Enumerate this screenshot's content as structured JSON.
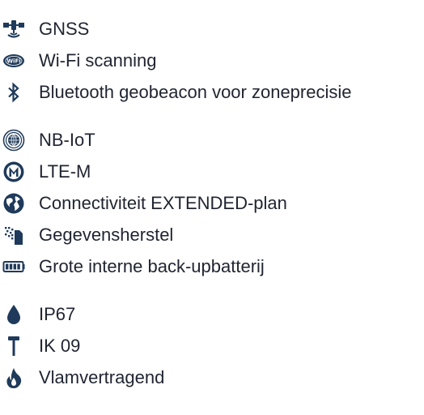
{
  "groups": [
    {
      "items": [
        {
          "icon": "satellite-icon",
          "label": "GNSS"
        },
        {
          "icon": "wifi-badge-icon",
          "label": "Wi-Fi scanning"
        },
        {
          "icon": "bluetooth-icon",
          "label": "Bluetooth geobeacon voor zoneprecisie"
        }
      ]
    },
    {
      "items": [
        {
          "icon": "nbiot-antenna-icon",
          "label": "NB-IoT"
        },
        {
          "icon": "ltem-badge-icon",
          "label": "LTE-M"
        },
        {
          "icon": "globe-icon",
          "label": "Connectiviteit EXTENDED-plan"
        },
        {
          "icon": "data-recovery-icon",
          "label": "Gegevensherstel"
        },
        {
          "icon": "battery-icon",
          "label": "Grote interne back-upbatterij"
        }
      ]
    },
    {
      "items": [
        {
          "icon": "water-drop-icon",
          "label": "IP67"
        },
        {
          "icon": "hammer-icon",
          "label": "IK 09"
        },
        {
          "icon": "flame-icon",
          "label": "Vlamvertragend"
        }
      ]
    }
  ],
  "colors": {
    "icon": "#1f3a5a",
    "text": "#1f2430",
    "background": "#ffffff"
  }
}
